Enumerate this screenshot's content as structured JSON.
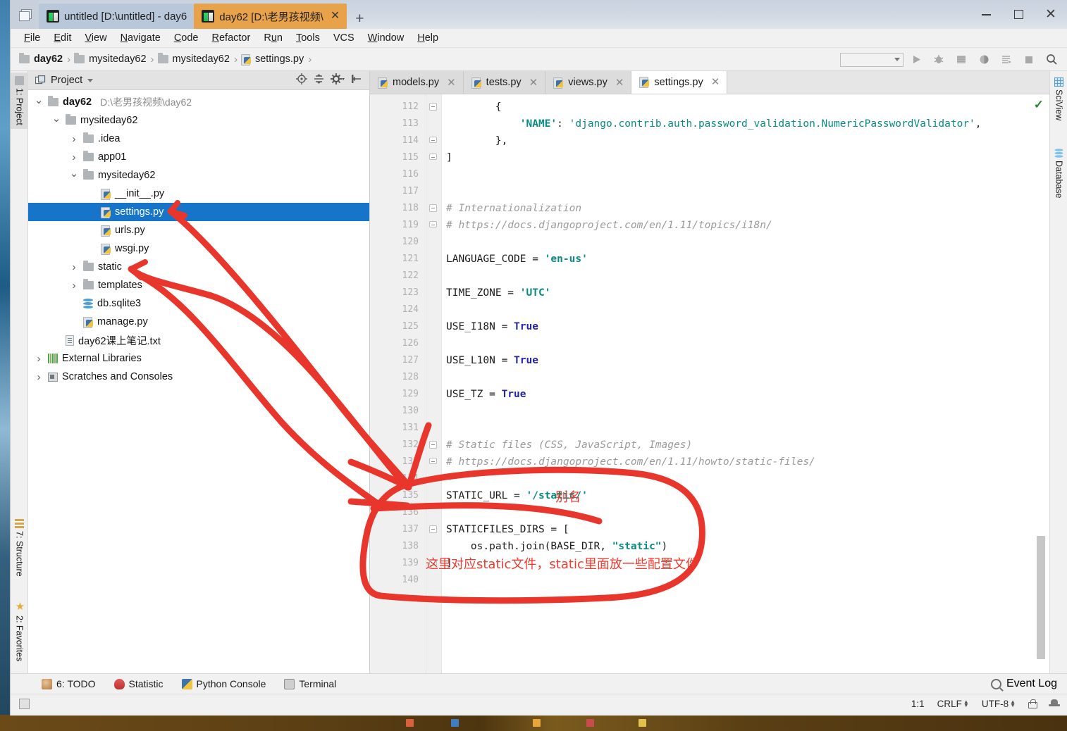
{
  "window": {
    "project_tabs": [
      {
        "label": "untitled [D:\\untitled] - day6",
        "active": false,
        "icon": "pycharm-icon"
      },
      {
        "label": "day62 [D:\\老男孩视频\\",
        "active": true,
        "icon": "pycharm-icon"
      }
    ],
    "new_tab_label": "+",
    "controls": {
      "minimize": "—",
      "maximize": "□",
      "close": "×"
    }
  },
  "menubar": {
    "items": [
      "File",
      "Edit",
      "View",
      "Navigate",
      "Code",
      "Refactor",
      "Run",
      "Tools",
      "VCS",
      "Window",
      "Help"
    ]
  },
  "navbar": {
    "breadcrumb": [
      {
        "label": "day62",
        "icon": "folder-icon",
        "bold": true
      },
      {
        "label": "mysiteday62",
        "icon": "folder-icon",
        "bold": false
      },
      {
        "label": "mysiteday62",
        "icon": "folder-icon",
        "bold": false
      },
      {
        "label": "settings.py",
        "icon": "python-file-icon",
        "bold": false
      }
    ],
    "separator": "›",
    "run_config_placeholder": "",
    "buttons": [
      {
        "name": "run-button",
        "glyph": "▶"
      },
      {
        "name": "debug-button",
        "glyph": "🐞"
      },
      {
        "name": "coverage-button",
        "glyph": "░"
      },
      {
        "name": "profile-button",
        "glyph": "◐"
      },
      {
        "name": "run-with-console-button",
        "glyph": "≡"
      },
      {
        "name": "stop-button",
        "glyph": "■"
      },
      {
        "name": "search-everywhere-button",
        "glyph": "🔍"
      }
    ]
  },
  "left_rail": {
    "top": [
      {
        "label": "1: Project",
        "icon": "project-icon"
      }
    ],
    "bottom": [
      {
        "label": "7: Structure",
        "icon": "structure-icon"
      },
      {
        "label": "2: Favorites",
        "icon": "star-icon"
      }
    ]
  },
  "right_rail": {
    "items": [
      {
        "label": "SciView",
        "icon": "grid-icon"
      },
      {
        "label": "Database",
        "icon": "database-icon"
      }
    ]
  },
  "project_panel": {
    "title": "Project",
    "dropdown": "▾",
    "tools": [
      {
        "name": "locate-file-icon"
      },
      {
        "name": "collapse-all-icon"
      },
      {
        "name": "settings-gear-icon"
      },
      {
        "name": "hide-panel-icon"
      }
    ],
    "tree": [
      {
        "indent": 0,
        "twisty": "open",
        "icon": "folder-icon",
        "label": "day62",
        "bold": true,
        "sub": "D:\\老男孩视频\\day62",
        "selected": false
      },
      {
        "indent": 1,
        "twisty": "open",
        "icon": "module-icon",
        "label": "mysiteday62",
        "bold": false,
        "sub": "",
        "selected": false
      },
      {
        "indent": 2,
        "twisty": "closed",
        "icon": "folder-icon",
        "label": ".idea",
        "bold": false,
        "sub": "",
        "selected": false
      },
      {
        "indent": 2,
        "twisty": "closed",
        "icon": "module-icon",
        "label": "app01",
        "bold": false,
        "sub": "",
        "selected": false
      },
      {
        "indent": 2,
        "twisty": "open",
        "icon": "module-icon",
        "label": "mysiteday62",
        "bold": false,
        "sub": "",
        "selected": false
      },
      {
        "indent": 3,
        "twisty": "none",
        "icon": "python-file-icon",
        "label": "__init__.py",
        "bold": false,
        "sub": "",
        "selected": false
      },
      {
        "indent": 3,
        "twisty": "none",
        "icon": "python-file-icon",
        "label": "settings.py",
        "bold": false,
        "sub": "",
        "selected": true
      },
      {
        "indent": 3,
        "twisty": "none",
        "icon": "python-file-icon",
        "label": "urls.py",
        "bold": false,
        "sub": "",
        "selected": false
      },
      {
        "indent": 3,
        "twisty": "none",
        "icon": "python-file-icon",
        "label": "wsgi.py",
        "bold": false,
        "sub": "",
        "selected": false
      },
      {
        "indent": 2,
        "twisty": "closed",
        "icon": "module-icon",
        "label": "static",
        "bold": false,
        "sub": "",
        "selected": false
      },
      {
        "indent": 2,
        "twisty": "closed",
        "icon": "module-icon",
        "label": "templates",
        "bold": false,
        "sub": "",
        "selected": false
      },
      {
        "indent": 2,
        "twisty": "none",
        "icon": "database-icon",
        "label": "db.sqlite3",
        "bold": false,
        "sub": "",
        "selected": false
      },
      {
        "indent": 2,
        "twisty": "none",
        "icon": "python-file-icon",
        "label": "manage.py",
        "bold": false,
        "sub": "",
        "selected": false
      },
      {
        "indent": 1,
        "twisty": "none",
        "icon": "text-file-icon",
        "label": "day62课上笔记.txt",
        "bold": false,
        "sub": "",
        "selected": false
      },
      {
        "indent": 0,
        "twisty": "closed",
        "icon": "libraries-icon",
        "label": "External Libraries",
        "bold": false,
        "sub": "",
        "selected": false
      },
      {
        "indent": 0,
        "twisty": "closed",
        "icon": "scratches-icon",
        "label": "Scratches and Consoles",
        "bold": false,
        "sub": "",
        "selected": false
      }
    ]
  },
  "editor": {
    "tabs": [
      {
        "label": "models.py",
        "active": false
      },
      {
        "label": "tests.py",
        "active": false
      },
      {
        "label": "views.py",
        "active": false
      },
      {
        "label": "settings.py",
        "active": true
      }
    ],
    "close_glyph": "×",
    "inspection_status": "✓",
    "first_line_number": 112,
    "lines": [
      {
        "n": 112,
        "fold": "start",
        "segments": [
          {
            "t": "        {",
            "c": "plain"
          }
        ]
      },
      {
        "n": 113,
        "fold": "none",
        "segments": [
          {
            "t": "            ",
            "c": "plain"
          },
          {
            "t": "'NAME'",
            "c": "str"
          },
          {
            "t": ": ",
            "c": "plain"
          },
          {
            "t": "'django.contrib.auth.password_validation.NumericPasswordValidator'",
            "c": "str-plain"
          },
          {
            "t": ",",
            "c": "plain"
          }
        ]
      },
      {
        "n": 114,
        "fold": "end",
        "segments": [
          {
            "t": "        },",
            "c": "plain"
          }
        ]
      },
      {
        "n": 115,
        "fold": "end",
        "segments": [
          {
            "t": "]",
            "c": "plain"
          }
        ]
      },
      {
        "n": 116,
        "fold": "none",
        "segments": [
          {
            "t": "",
            "c": "plain"
          }
        ]
      },
      {
        "n": 117,
        "fold": "none",
        "segments": [
          {
            "t": "",
            "c": "plain"
          }
        ]
      },
      {
        "n": 118,
        "fold": "start",
        "segments": [
          {
            "t": "# Internationalization",
            "c": "cmt"
          }
        ]
      },
      {
        "n": 119,
        "fold": "end",
        "segments": [
          {
            "t": "# https://docs.djangoproject.com/en/1.11/topics/i18n/",
            "c": "cmt"
          }
        ]
      },
      {
        "n": 120,
        "fold": "none",
        "segments": [
          {
            "t": "",
            "c": "plain"
          }
        ]
      },
      {
        "n": 121,
        "fold": "none",
        "segments": [
          {
            "t": "LANGUAGE_CODE = ",
            "c": "plain"
          },
          {
            "t": "'en-us'",
            "c": "str"
          }
        ]
      },
      {
        "n": 122,
        "fold": "none",
        "segments": [
          {
            "t": "",
            "c": "plain"
          }
        ]
      },
      {
        "n": 123,
        "fold": "none",
        "segments": [
          {
            "t": "TIME_ZONE = ",
            "c": "plain"
          },
          {
            "t": "'UTC'",
            "c": "str"
          }
        ]
      },
      {
        "n": 124,
        "fold": "none",
        "segments": [
          {
            "t": "",
            "c": "plain"
          }
        ]
      },
      {
        "n": 125,
        "fold": "none",
        "segments": [
          {
            "t": "USE_I18N = ",
            "c": "plain"
          },
          {
            "t": "True",
            "c": "kw"
          }
        ]
      },
      {
        "n": 126,
        "fold": "none",
        "segments": [
          {
            "t": "",
            "c": "plain"
          }
        ]
      },
      {
        "n": 127,
        "fold": "none",
        "segments": [
          {
            "t": "USE_L10N = ",
            "c": "plain"
          },
          {
            "t": "True",
            "c": "kw"
          }
        ]
      },
      {
        "n": 128,
        "fold": "none",
        "segments": [
          {
            "t": "",
            "c": "plain"
          }
        ]
      },
      {
        "n": 129,
        "fold": "none",
        "segments": [
          {
            "t": "USE_TZ = ",
            "c": "plain"
          },
          {
            "t": "True",
            "c": "kw"
          }
        ]
      },
      {
        "n": 130,
        "fold": "none",
        "segments": [
          {
            "t": "",
            "c": "plain"
          }
        ]
      },
      {
        "n": 131,
        "fold": "none",
        "segments": [
          {
            "t": "",
            "c": "plain"
          }
        ]
      },
      {
        "n": 132,
        "fold": "start",
        "segments": [
          {
            "t": "# Static files (CSS, JavaScript, Images)",
            "c": "cmt"
          }
        ]
      },
      {
        "n": 133,
        "fold": "end",
        "segments": [
          {
            "t": "# https://docs.djangoproject.com/en/1.11/howto/static-files/",
            "c": "cmt"
          }
        ]
      },
      {
        "n": 134,
        "fold": "none",
        "segments": [
          {
            "t": "",
            "c": "plain"
          }
        ]
      },
      {
        "n": 135,
        "fold": "none",
        "segments": [
          {
            "t": "STATIC_URL = ",
            "c": "plain"
          },
          {
            "t": "'/static/'",
            "c": "str"
          }
        ]
      },
      {
        "n": 136,
        "fold": "none",
        "segments": [
          {
            "t": "",
            "c": "plain"
          }
        ]
      },
      {
        "n": 137,
        "fold": "start",
        "segments": [
          {
            "t": "STATICFILES_DIRS = [",
            "c": "plain"
          }
        ]
      },
      {
        "n": 138,
        "fold": "none",
        "segments": [
          {
            "t": "    os.path.join(BASE_DIR, ",
            "c": "plain"
          },
          {
            "t": "\"static\"",
            "c": "str"
          },
          {
            "t": ")",
            "c": "plain"
          }
        ]
      },
      {
        "n": 139,
        "fold": "end",
        "segments": [
          {
            "t": "]",
            "c": "plain"
          }
        ]
      },
      {
        "n": 140,
        "fold": "none",
        "segments": [
          {
            "t": "",
            "c": "plain"
          }
        ]
      }
    ]
  },
  "annotations": {
    "color": "#e8362c",
    "alias_label": "别名",
    "note_label": "这里对应static文件，static里面放一些配置文件"
  },
  "bottom_strip": {
    "items": [
      {
        "label": "6: TODO",
        "icon": "todo-icon"
      },
      {
        "label": "Statistic",
        "icon": "statistic-icon"
      },
      {
        "label": "Python Console",
        "icon": "python-console-icon"
      },
      {
        "label": "Terminal",
        "icon": "terminal-icon"
      }
    ],
    "event_log": "Event Log"
  },
  "statusbar": {
    "caret": "1:1",
    "line_separator": "CRLF",
    "encoding": "UTF-8",
    "lock": "lock-icon",
    "inspection_profile": "hat-icon"
  }
}
